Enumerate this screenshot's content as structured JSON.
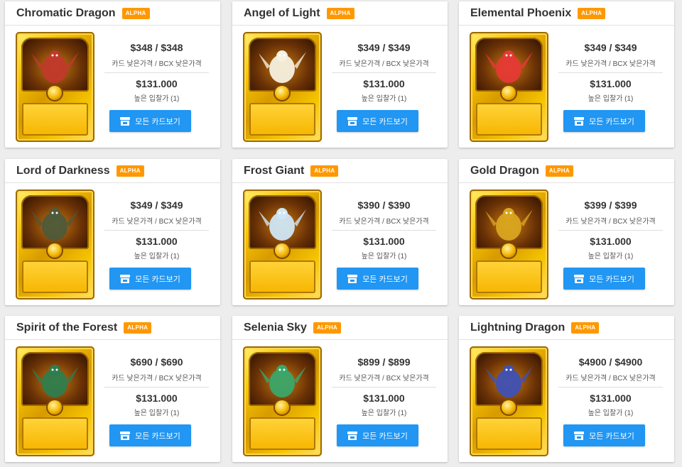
{
  "listings": [
    {
      "name": "Chromatic Dragon",
      "edition": "ALPHA",
      "price": "$348 / $348",
      "price_label": "카드 낮은가격 / BCX 낮은가격",
      "bid": "$131.000",
      "bid_label": "높은 입찰가 (1)",
      "button": "모든 카드보기",
      "art_color": "#c0392b"
    },
    {
      "name": "Angel of Light",
      "edition": "ALPHA",
      "price": "$349 / $349",
      "price_label": "카드 낮은가격 / BCX 낮은가격",
      "bid": "$131.000",
      "bid_label": "높은 입찰가 (1)",
      "button": "모든 카드보기",
      "art_color": "#f5f0e0"
    },
    {
      "name": "Elemental Phoenix",
      "edition": "ALPHA",
      "price": "$349 / $349",
      "price_label": "카드 낮은가격 / BCX 낮은가격",
      "bid": "$131.000",
      "bid_label": "높은 입찰가 (1)",
      "button": "모든 카드보기",
      "art_color": "#e53935"
    },
    {
      "name": "Lord of Darkness",
      "edition": "ALPHA",
      "price": "$349 / $349",
      "price_label": "카드 낮은가격 / BCX 낮은가격",
      "bid": "$131.000",
      "bid_label": "높은 입찰가 (1)",
      "button": "모든 카드보기",
      "art_color": "#4e5a3a"
    },
    {
      "name": "Frost Giant",
      "edition": "ALPHA",
      "price": "$390 / $390",
      "price_label": "카드 낮은가격 / BCX 낮은가격",
      "bid": "$131.000",
      "bid_label": "높은 입찰가 (1)",
      "button": "모든 카드보기",
      "art_color": "#cfe6f5"
    },
    {
      "name": "Gold Dragon",
      "edition": "ALPHA",
      "price": "$399 / $399",
      "price_label": "카드 낮은가격 / BCX 낮은가격",
      "bid": "$131.000",
      "bid_label": "높은 입찰가 (1)",
      "button": "모든 카드보기",
      "art_color": "#d9a520"
    },
    {
      "name": "Spirit of the Forest",
      "edition": "ALPHA",
      "price": "$690 / $690",
      "price_label": "카드 낮은가격 / BCX 낮은가격",
      "bid": "$131.000",
      "bid_label": "높은 입찰가 (1)",
      "button": "모든 카드보기",
      "art_color": "#2e7d4f"
    },
    {
      "name": "Selenia Sky",
      "edition": "ALPHA",
      "price": "$899 / $899",
      "price_label": "카드 낮은가격 / BCX 낮은가격",
      "bid": "$131.000",
      "bid_label": "높은 입찰가 (1)",
      "button": "모든 카드보기",
      "art_color": "#3aa66a"
    },
    {
      "name": "Lightning Dragon",
      "edition": "ALPHA",
      "price": "$4900 / $4900",
      "price_label": "카드 낮은가격 / BCX 낮은가격",
      "bid": "$131.000",
      "bid_label": "높은 입찰가 (1)",
      "button": "모든 카드보기",
      "art_color": "#3f51b5"
    }
  ],
  "colors": {
    "badge": "#ff9800",
    "button": "#2196f3",
    "background": "#ededed"
  },
  "icons": {
    "button_icon": "store-icon"
  }
}
